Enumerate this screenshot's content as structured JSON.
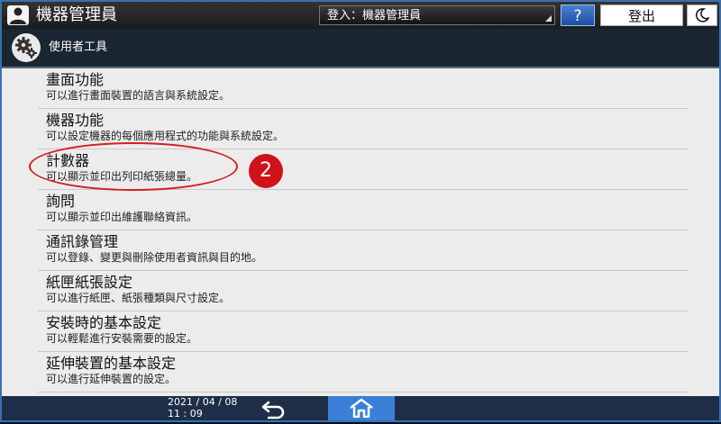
{
  "topbar": {
    "user_name": "機器管理員",
    "login_label": "登入：機器管理員",
    "help_label": "?",
    "logout_label": "登出"
  },
  "header": {
    "title": "使用者工具"
  },
  "items": [
    {
      "title": "畫面功能",
      "desc": "可以進行畫面裝置的語言與系統設定。"
    },
    {
      "title": "機器功能",
      "desc": "可以設定機器的每個應用程式的功能與系統設定。"
    },
    {
      "title": "計數器",
      "desc": "可以顯示並印出列印紙張總量。"
    },
    {
      "title": "詢問",
      "desc": "可以顯示並印出維護聯絡資訊。"
    },
    {
      "title": "通訊錄管理",
      "desc": "可以登錄、變更與刪除使用者資訊與目的地。"
    },
    {
      "title": "紙匣紙張設定",
      "desc": "可以進行紙匣、紙張種類與尺寸設定。"
    },
    {
      "title": "安裝時的基本設定",
      "desc": "可以輕鬆進行安裝需要的設定。"
    },
    {
      "title": "延伸裝置的基本設定",
      "desc": "可以進行延伸裝置的設定。"
    }
  ],
  "callout": {
    "step_number": "2"
  },
  "bottombar": {
    "date": "2021 / 04 / 08",
    "time": "11 : 09"
  },
  "colors": {
    "accent_blue": "#3b7fd6",
    "callout_red": "#d0121b",
    "list_bg": "#ececec"
  },
  "icons": [
    "user-icon",
    "gear-icon",
    "moon-icon",
    "back-arrow-icon",
    "home-icon"
  ]
}
